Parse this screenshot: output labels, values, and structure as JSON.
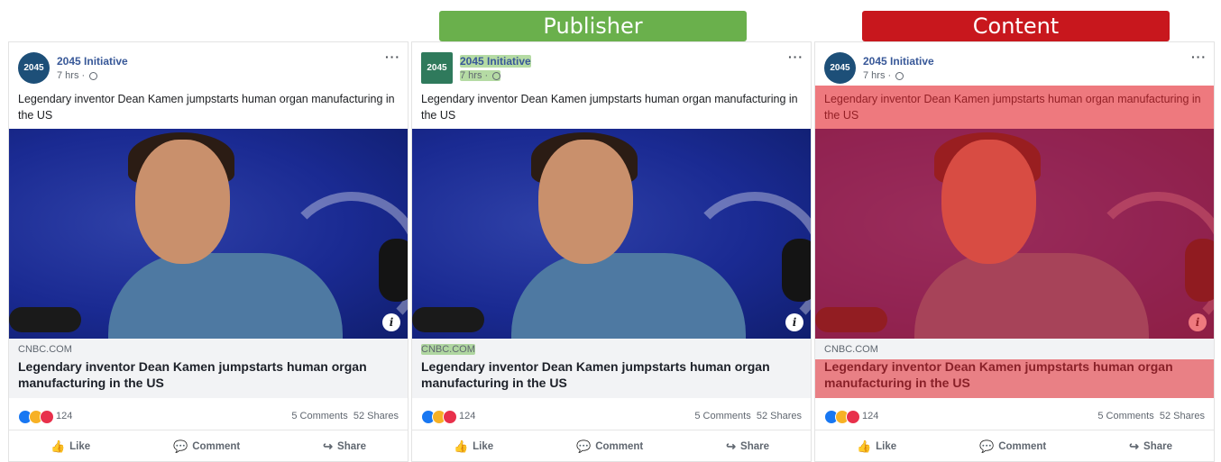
{
  "banners": {
    "publisher": "Publisher",
    "content": "Content"
  },
  "post": {
    "page_name": "2045 Initiative",
    "avatar_text": "2045",
    "time": "7 hrs ·",
    "more": "···",
    "text": "Legendary inventor Dean Kamen jumpstarts human organ manufacturing in the US",
    "domain": "CNBC.COM",
    "link_title": "Legendary inventor Dean Kamen jumpstarts human organ manufacturing in the US",
    "reaction_count": "124",
    "comments": "5 Comments",
    "shares": "52 Shares",
    "actions": {
      "like": "Like",
      "comment": "Comment",
      "share": "Share"
    },
    "info": "i"
  },
  "colors": {
    "publisher_banner": "#6ab04c",
    "content_banner": "#c8171d",
    "name_blue": "#385898"
  }
}
